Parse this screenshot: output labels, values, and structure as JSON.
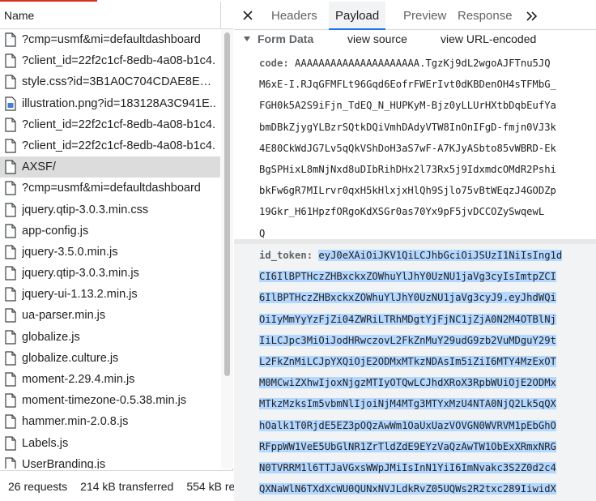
{
  "left": {
    "header_label": "Name",
    "files": [
      {
        "name": "?cmp=usmf&mi=defaultdashboard",
        "icon": "document-icon"
      },
      {
        "name": "?client_id=22f2c1cf-8edb-4a08-b1c4.",
        "icon": "document-icon"
      },
      {
        "name": "style.css?id=3B1A0C704CDAE8ECD4.",
        "icon": "stylesheet-icon"
      },
      {
        "name": "illustration.png?id=183128A3C941E..",
        "icon": "image-file-icon"
      },
      {
        "name": "?client_id=22f2c1cf-8edb-4a08-b1c4.",
        "icon": "document-icon"
      },
      {
        "name": "?client_id=22f2c1cf-8edb-4a08-b1c4.",
        "icon": "document-icon"
      },
      {
        "name": "AXSF/",
        "icon": "document-icon",
        "selected": true
      },
      {
        "name": "?cmp=usmf&mi=defaultdashboard",
        "icon": "document-icon"
      },
      {
        "name": "jquery.qtip-3.0.3.min.css",
        "icon": "stylesheet-icon"
      },
      {
        "name": "app-config.js",
        "icon": "script-icon"
      },
      {
        "name": "jquery-3.5.0.min.js",
        "icon": "script-icon"
      },
      {
        "name": "jquery.qtip-3.0.3.min.js",
        "icon": "script-icon"
      },
      {
        "name": "jquery-ui-1.13.2.min.js",
        "icon": "script-icon"
      },
      {
        "name": "ua-parser.min.js",
        "icon": "script-icon"
      },
      {
        "name": "globalize.js",
        "icon": "script-icon"
      },
      {
        "name": "globalize.culture.js",
        "icon": "script-icon"
      },
      {
        "name": "moment-2.29.4.min.js",
        "icon": "script-icon"
      },
      {
        "name": "moment-timezone-0.5.38.min.js",
        "icon": "script-icon"
      },
      {
        "name": "hammer.min-2.0.8.js",
        "icon": "script-icon"
      },
      {
        "name": "Labels.js",
        "icon": "script-icon"
      },
      {
        "name": "UserBranding.js",
        "icon": "script-icon"
      }
    ],
    "status": {
      "requests": "26 requests",
      "transferred": "214 kB transferred",
      "resources": "554 kB re"
    }
  },
  "right": {
    "tabs": [
      "Headers",
      "Payload",
      "Preview",
      "Response"
    ],
    "active_tab": "Payload",
    "form_data": {
      "title": "Form Data",
      "view_source": "view source",
      "view_url_encoded": "view URL-encoded",
      "code_key": "code:",
      "code_lines": [
        "AAAAAAAAAAAAAAAAAAAAA.TgzKj9dL2wgoAJFTnu5JQ",
        "M6xE-I.RJqGFMFLt96Gqd6EofrFWErIvt0dKBDenOH4sTFMbG_",
        "FGH0k5A2S9iFjn_TdEQ_N_HUPKyM-Bjz0yLLUrHXtbDqbEufYa",
        "bmDBkZjygYLBzrSQtkDQiVmhDAdyVTW8InOnIFgD-fmjn0VJ3k",
        "4E80CkWdJG7Lv5qQkVShDoH3aS7wF-A7KJyASbto85vWBRD-Ek",
        "BgSPHixL8mNjNxd8uDIbRihDHx2l73Rx5j9IdxmdcOMdR2Pshi",
        "bkFw6gR7MILrvr0qxH5kHlxjxHlQh9Sjlo75vBtWEqzJ4GODZp",
        "19Gkr_H61HpzfORgoKdXSGr0as70Yx9pF5jvDCCOZySwqewL",
        "Q"
      ],
      "id_token_key": "id_token:",
      "id_token_lines": [
        "eyJ0eXAiOiJKV1QiLCJhbGciOiJSUzI1NiIsIng1d",
        "CI6IlBPTHczZHBxckxZOWhuYlJhY0UzNU1jaVg3cyIsImtpZCI",
        "6IlBPTHczZHBxckxZOWhuYlJhY0UzNU1jaVg3cyJ9.eyJhdWQi",
        "OiIyMmYyYzFjZi04ZWRiLTRhMDgtYjFjNC1jZjA0N2M4OTBlNj",
        "IiLCJpc3MiOiJodHRwczovL2FkZnMuY29udG9zb2VuMDguY29t",
        "L2FkZnMiLCJpYXQiOjE2ODMxMTkzNDAsIm5iZiI6MTY4MzExOT",
        "M0MCwiZXhwIjoxNjgzMTIyOTQwLCJhdXRoX3RpbWUiOjE2ODMx",
        "MTkzMzksIm5vbmNlIjoiNjM4MTg3MTYxMzU4NTA0NjQ2Lk5qQX",
        "hOalk1T0RjdE5EZ3pOQzAwWm1OaUxUazVOVGN0WVRVM1pEbGhO",
        "RFppWW1VeE5UbGlNR1ZrTldZdE9EYzVaQzAwTW1ObExXRmxNRG",
        "N0TVRRM1l6TTJaVGxsWWpJMiIsInN1YiI6ImNvakc3S2Z0d2c4",
        "QXNaWlN6TXdXcWU0QUNxNVJLdkRvZ05UQWs2R2txc289IiwidX"
      ]
    }
  }
}
